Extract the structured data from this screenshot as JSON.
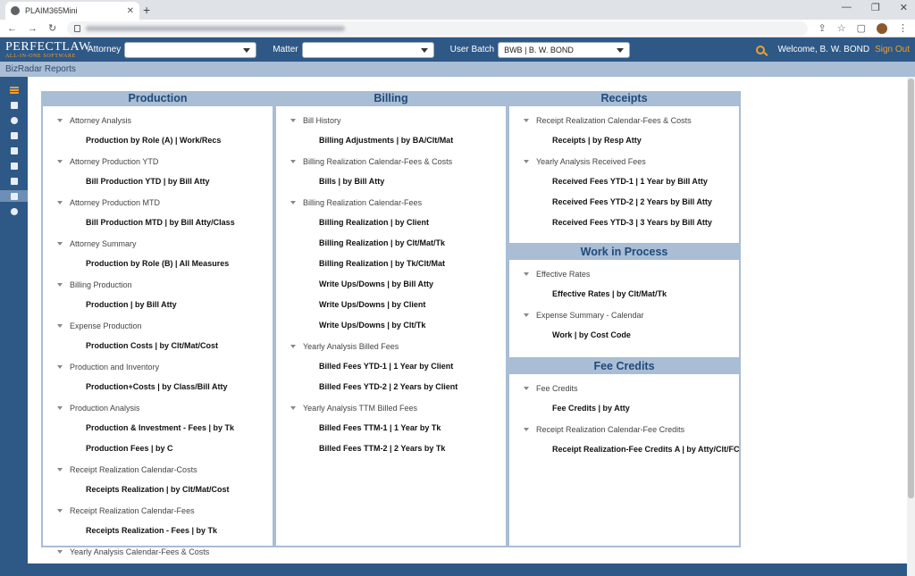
{
  "browser": {
    "tab_title": "PLAIM365Mini",
    "tab_close": "✕",
    "new_tab": "+",
    "win_min": "—",
    "win_max": "❐",
    "win_close": "✕",
    "back": "←",
    "forward": "→",
    "reload": "↻"
  },
  "header": {
    "logo_main": "PERFECTLAW",
    "logo_sub": "ALL-IN-ONE SOFTWARE",
    "attorney_label": "Attorney",
    "attorney_value": "",
    "matter_label": "Matter",
    "matter_value": "",
    "batch_label": "User Batch",
    "batch_value": "BWB | B. W. BOND",
    "welcome": "Welcome, B. W. BOND",
    "signout": "Sign Out"
  },
  "subbar": {
    "title": "BizRadar Reports"
  },
  "columns": [
    {
      "panels": [
        {
          "title": "Production",
          "groups": [
            {
              "label": "Attorney Analysis",
              "reports": [
                "Production by Role (A) | Work/Recs"
              ]
            },
            {
              "label": "Attorney Production YTD",
              "reports": [
                "Bill Production YTD | by Bill Atty"
              ]
            },
            {
              "label": "Attorney Production MTD",
              "reports": [
                "Bill Production MTD | by Bill Atty/Class"
              ]
            },
            {
              "label": "Attorney Summary",
              "reports": [
                "Production by Role (B) | All Measures"
              ]
            },
            {
              "label": "Billing Production",
              "reports": [
                "Production | by Bill Atty"
              ]
            },
            {
              "label": "Expense Production",
              "reports": [
                "Production Costs | by Clt/Mat/Cost"
              ]
            },
            {
              "label": "Production and Inventory",
              "reports": [
                "Production+Costs | by Class/Bill Atty"
              ]
            },
            {
              "label": "Production Analysis",
              "reports": [
                "Production & Investment - Fees | by Tk",
                "Production Fees | by C"
              ]
            },
            {
              "label": "Receipt Realization Calendar-Costs",
              "reports": [
                "Receipts Realization | by Clt/Mat/Cost"
              ]
            },
            {
              "label": "Receipt Realization Calendar-Fees",
              "reports": [
                "Receipts Realization - Fees | by Tk"
              ]
            },
            {
              "label": "Yearly Analysis Calendar-Fees & Costs",
              "reports": []
            }
          ]
        }
      ]
    },
    {
      "panels": [
        {
          "title": "Billing",
          "groups": [
            {
              "label": "Bill History",
              "reports": [
                "Billing Adjustments | by BA/Clt/Mat"
              ]
            },
            {
              "label": "Billing Realization Calendar-Fees & Costs",
              "reports": [
                "Bills | by Bill Atty"
              ]
            },
            {
              "label": "Billing Realization Calendar-Fees",
              "reports": [
                "Billing Realization | by Client",
                "Billing Realization | by Clt/Mat/Tk",
                "Billing Realization | by Tk/Clt/Mat",
                "Write Ups/Downs | by Bill Atty",
                "Write Ups/Downs | by Client",
                "Write Ups/Downs | by Clt/Tk"
              ]
            },
            {
              "label": "Yearly Analysis Billed Fees",
              "reports": [
                "Billed Fees YTD-1 | 1 Year by Client",
                "Billed Fees YTD-2 | 2 Years by Client"
              ]
            },
            {
              "label": "Yearly Analysis TTM Billed Fees",
              "reports": [
                "Billed Fees TTM-1 | 1 Year by Tk",
                "Billed Fees TTM-2 | 2 Years by Tk"
              ]
            }
          ]
        }
      ]
    },
    {
      "panels": [
        {
          "title": "Receipts",
          "groups": [
            {
              "label": "Receipt Realization Calendar-Fees & Costs",
              "reports": [
                "Receipts | by Resp Atty"
              ]
            },
            {
              "label": "Yearly Analysis Received Fees",
              "reports": [
                "Received Fees YTD-1 | 1 Year by Bill Atty",
                "Received Fees YTD-2 | 2 Years by Bill Atty",
                "Received Fees YTD-3 | 3 Years by Bill Atty"
              ]
            }
          ]
        },
        {
          "title": "Work in Process",
          "groups": [
            {
              "label": "Effective Rates",
              "reports": [
                "Effective Rates | by Clt/Mat/Tk"
              ]
            },
            {
              "label": "Expense Summary - Calendar",
              "reports": [
                "Work | by Cost Code"
              ]
            }
          ]
        },
        {
          "title": "Fee Credits",
          "groups": [
            {
              "label": "Fee Credits",
              "reports": [
                "Fee Credits | by Atty"
              ]
            },
            {
              "label": "Receipt Realization Calendar-Fee Credits",
              "reports": [
                "Receipt Realization-Fee Credits A | by Atty/Clt/FC"
              ]
            }
          ]
        }
      ]
    }
  ]
}
